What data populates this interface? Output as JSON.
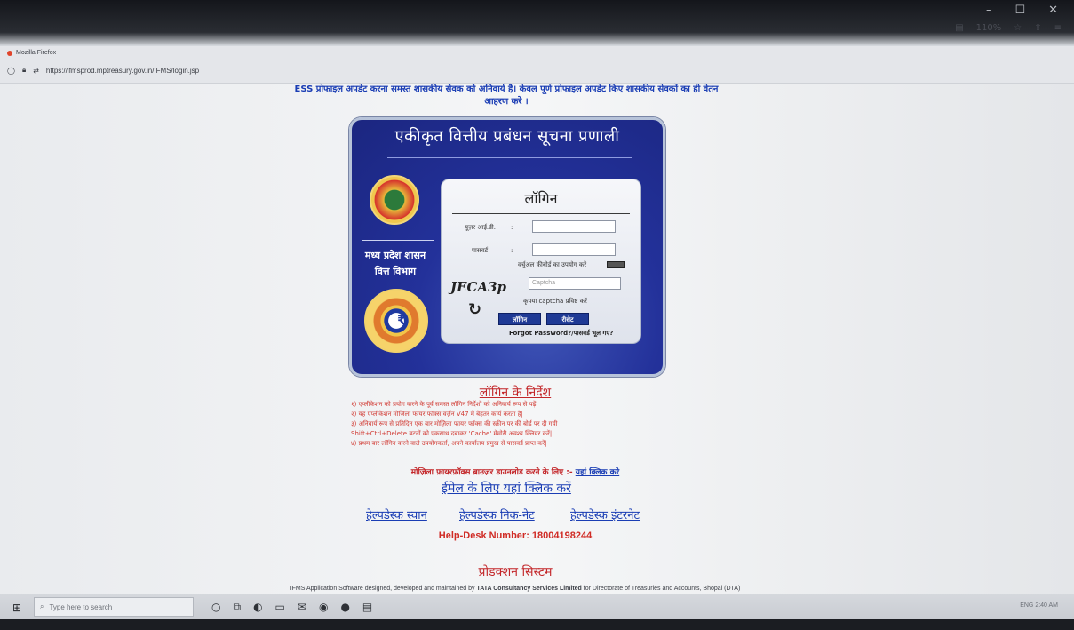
{
  "window": {
    "controls": [
      "–",
      "☐",
      "✕"
    ],
    "zoom": "110%",
    "browser_name": "Mozilla Firefox",
    "url": "https://ifmsprod.mptreasury.gov.in/IFMS/login.jsp"
  },
  "notice": "ESS प्रोफाइल अपडेट करना समस्त शासकीय सेवक को अनिवार्य है। केवल पूर्ण प्रोफाइल अपडेट किए शासकीय सेवकों का ही वेतन आहरण करे ।",
  "panel": {
    "title": "एकीकृत वित्तीय प्रबंधन सूचना प्रणाली",
    "department_line1": "मध्य प्रदेश शासन",
    "department_line2": "वित्त विभाग"
  },
  "login": {
    "title": "लॉगिन",
    "user_id_label": "यूज़र आई.डी.",
    "password_label": "पासवर्ड",
    "virtual_keyboard_label": "वर्चुअल कीबोर्ड का उपयोग करें",
    "captcha_text": "JECA3p",
    "captcha_placeholder": "Captcha",
    "captcha_hint": "कृपया captcha प्रविष्ट करें",
    "login_button": "लॉगिन",
    "reset_button": "रीसेट",
    "forgot_password": "Forgot Password?/पासवर्ड भूल गए?",
    "colon": ":"
  },
  "instructions": {
    "title": "लॉगिन के निर्देश",
    "items": [
      "१) एप्लीकेशन को प्रयोग करने के पूर्व समस्त लॉगिन निर्देशों को अनिवार्य रूप से पढ़ें|",
      "२) यह एप्लीकेशन मोज़िला फायर फॉक्स वर्ज़न V47 में बेहतर कार्य करता है|",
      "३) अनिवार्य रूप से प्रतिदिन एक बार मोज़िला फायर फॉक्स की स्क्रीन पर की बोर्ड पर दी गयी",
      "Shift+Ctrl+Delete बटनों को एकसाथ दबाकर 'Cache' मेमोरी अवश्य क्लियर करें|",
      "४) प्रथम बार लॉगिन करने वाले उपयोगकर्ता, अपने कार्यालय प्रमुख से पासवर्ड प्राप्त करें|"
    ]
  },
  "mozilla_download": {
    "text": "मोज़िला फ़ायरफ़ॉक्स ब्राउज़र डाउनलोड करने के लिए :-",
    "link": "यहां क्लिक करे"
  },
  "email_link": "ईमेल के लिए यहां क्लिक करें",
  "helpdesk": {
    "swan": "हेल्पडेस्क स्वान",
    "nicnet": "हेल्पडेस्क निक-नेट",
    "internet": "हेल्पडेस्क इंटरनेट",
    "number": "Help-Desk Number: 18004198244"
  },
  "production": "प्रोडक्शन सिस्टम",
  "footer": {
    "prefix": "IFMS Application Software designed, developed and maintained by",
    "company": "TATA Consultancy Services Limited",
    "suffix": "for Directorate of Treasuries and Accounts, Bhopal (DTA)"
  },
  "taskbar": {
    "search_placeholder": "Type here to search",
    "tray": "ENG  2:40 AM"
  }
}
